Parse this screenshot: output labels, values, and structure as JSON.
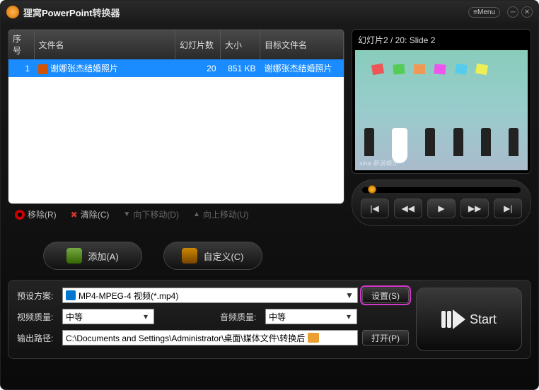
{
  "title": {
    "prefix": "狸窝",
    "main": "PowerPoint",
    "suffix": "转换器"
  },
  "menu_label": "Menu",
  "table": {
    "headers": {
      "index": "序号",
      "filename": "文件名",
      "slides": "幻灯片数",
      "size": "大小",
      "target": "目标文件名"
    },
    "rows": [
      {
        "index": "1",
        "filename": "谢娜张杰结婚照片",
        "slides": "20",
        "size": "851 KB",
        "target": "谢娜张杰结婚照片"
      }
    ]
  },
  "toolbar": {
    "remove": "移除(R)",
    "clear": "清除(C)",
    "movedown": "向下移动(D)",
    "moveup": "向上移动(U)"
  },
  "mid": {
    "add": "添加(A)",
    "custom": "自定义(C)"
  },
  "preview": {
    "label": "幻灯片2 / 20: Slide 2",
    "watermark": "sina 新浪娱乐"
  },
  "bottom": {
    "preset_label": "预设方案:",
    "preset_value": "MP4-MPEG-4 视频(*.mp4)",
    "settings": "设置(S)",
    "vq_label": "视频质量:",
    "vq_value": "中等",
    "aq_label": "音频质量:",
    "aq_value": "中等",
    "out_label": "输出路径:",
    "out_value": "C:\\Documents and Settings\\Administrator\\桌面\\媒体文件\\转换后",
    "open": "打开(P)"
  },
  "start": "Start"
}
